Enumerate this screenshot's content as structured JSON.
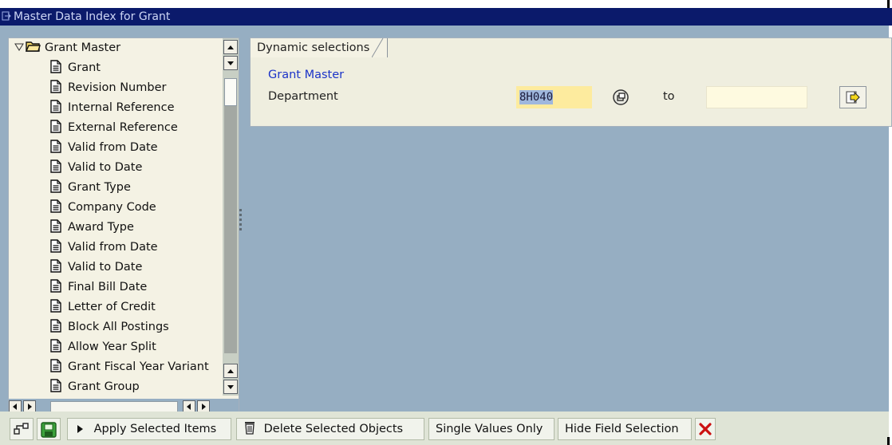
{
  "window": {
    "title": "Master Data Index for Grant"
  },
  "tree": {
    "root_label": "Grant Master",
    "items": [
      {
        "label": "Grant"
      },
      {
        "label": "Revision Number"
      },
      {
        "label": "Internal Reference"
      },
      {
        "label": "External Reference"
      },
      {
        "label": "Valid from Date"
      },
      {
        "label": "Valid to Date"
      },
      {
        "label": "Grant Type"
      },
      {
        "label": "Company Code"
      },
      {
        "label": "Award Type"
      },
      {
        "label": "Valid from Date"
      },
      {
        "label": "Valid to Date"
      },
      {
        "label": "Final Bill Date"
      },
      {
        "label": "Letter of Credit"
      },
      {
        "label": "Block All Postings"
      },
      {
        "label": "Allow Year Split"
      },
      {
        "label": "Grant Fiscal Year Variant"
      },
      {
        "label": "Grant Group"
      }
    ]
  },
  "selections": {
    "tab_label": "Dynamic selections",
    "group_title": "Grant Master",
    "field_label": "Department",
    "low_value": "8H040",
    "to_label": "to",
    "high_value": ""
  },
  "toolbar": {
    "apply_label": "Apply Selected Items",
    "delete_label": "Delete Selected Objects",
    "single_values_label": "Single Values Only",
    "hide_field_label": "Hide Field Selection"
  },
  "icons": {
    "tree_toggle": "triangle-down-icon",
    "folder": "open-folder-icon",
    "document": "document-icon",
    "multiple_selection": "multiple-selection-icon",
    "execute_arrow": "arrow-right-icon",
    "hierarchy": "hierarchy-icon",
    "save": "save-icon",
    "play": "play-icon",
    "trash": "trash-icon",
    "cancel": "cancel-x-icon"
  },
  "colors": {
    "title_bar": "#0b1a6b",
    "background": "#96aec2",
    "panel": "#f4f2e4",
    "group_title": "#1b33c8",
    "input_required": "#fdeb9e",
    "selected_text": "#9fb7dd",
    "cancel_icon": "#cc1111",
    "toolbar": "#dfe4d6"
  }
}
